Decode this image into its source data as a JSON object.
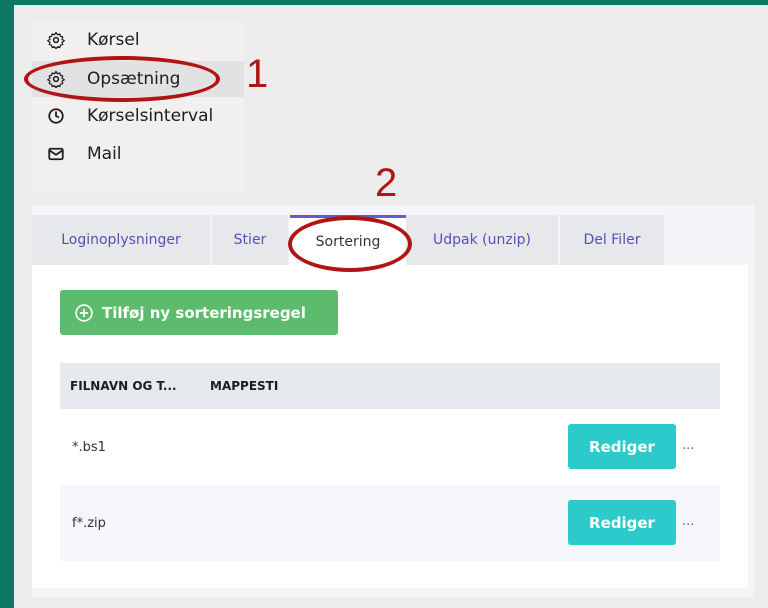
{
  "menu": {
    "items": [
      {
        "label": "Kørsel",
        "icon": "gear-icon"
      },
      {
        "label": "Opsætning",
        "icon": "gear-icon"
      },
      {
        "label": "Kørselsinterval",
        "icon": "clock-icon"
      },
      {
        "label": "Mail",
        "icon": "mail-icon"
      }
    ]
  },
  "annotations": {
    "one": "1",
    "two": "2",
    "color": "#b11414"
  },
  "tabs": [
    {
      "label": "Loginoplysninger"
    },
    {
      "label": "Stier"
    },
    {
      "label": "Sortering"
    },
    {
      "label": "Udpak (unzip)"
    },
    {
      "label": "Del Filer"
    }
  ],
  "add_button": {
    "label": "Tilføj ny sorteringsregel",
    "icon": "plus-circle-icon",
    "color": "#5cbb6d"
  },
  "table": {
    "headers": [
      "FILNAVN OG T...",
      "MAPPESTI"
    ],
    "rows": [
      {
        "name": "*.bs1",
        "edit": "Rediger",
        "more": "..."
      },
      {
        "name": "f*.zip",
        "edit": "Rediger",
        "more": "..."
      }
    ],
    "edit_color": "#2ccaca"
  }
}
